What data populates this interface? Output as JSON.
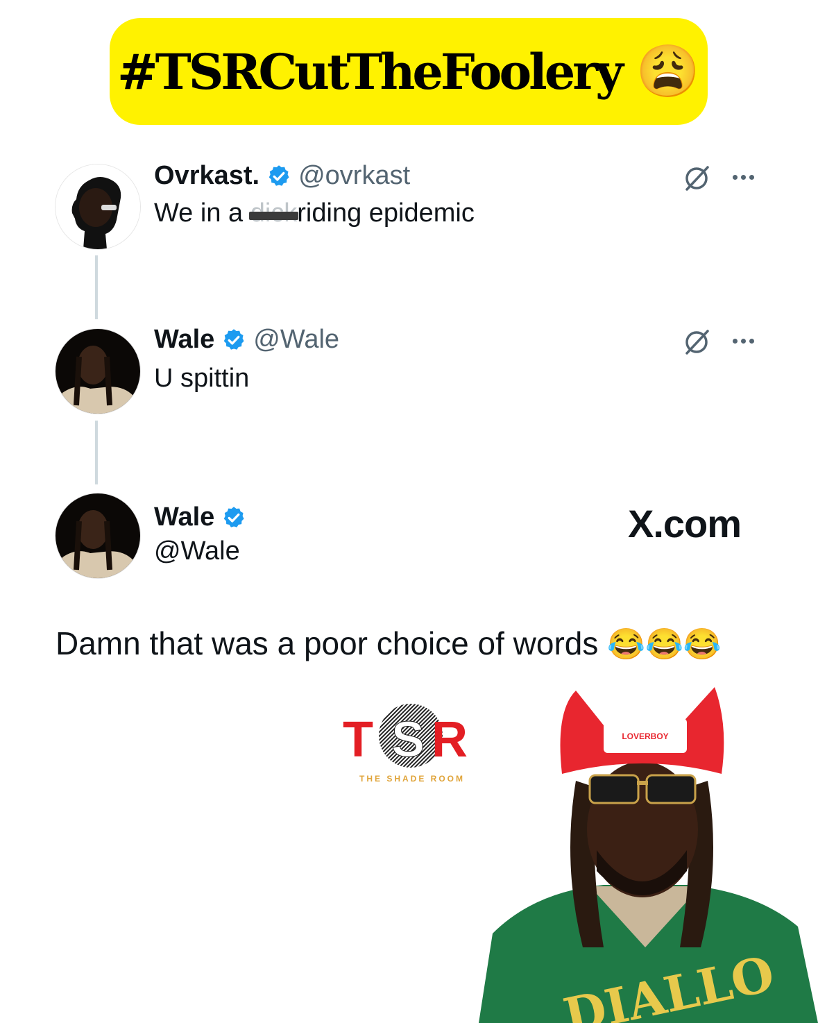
{
  "banner": {
    "hashtag": "#TSRCutTheFoolery",
    "emoji": "😩"
  },
  "tweets": [
    {
      "display_name": "Ovrkast.",
      "handle": "@ovrkast",
      "text_before": "We in a ",
      "censored": "dick",
      "text_after": "riding epidemic"
    },
    {
      "display_name": "Wale",
      "handle": "@Wale",
      "text": "U spittin"
    }
  ],
  "reply": {
    "display_name": "Wale",
    "handle": "@Wale",
    "site": "X.com",
    "text": "Damn that was a poor choice of words",
    "emojis": "😂😂😂"
  },
  "logo": {
    "letters": "TSR",
    "subtitle": "THE SHADE ROOM",
    "hat_text": "LOVERBOY",
    "shirt_text": "DIALLO"
  },
  "colors": {
    "banner": "#fff200",
    "verified": "#1d9bf0",
    "tsr_red": "#e31e24",
    "tsr_gold": "#e0a43a"
  }
}
